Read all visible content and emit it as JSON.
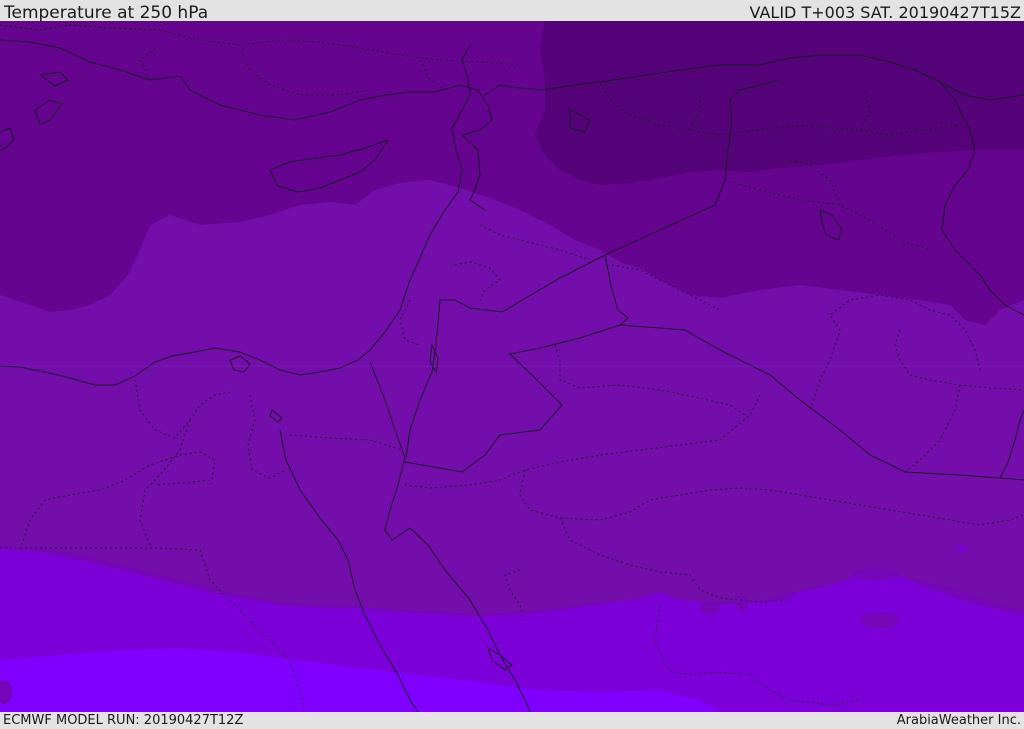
{
  "header": {
    "title": "Temperature at 250 hPa",
    "valid_time": "VALID T+003 SAT. 20190427T15Z"
  },
  "footer": {
    "model_run": "ECMWF MODEL RUN: 20190427T12Z",
    "credit": "ArabiaWeather Inc."
  },
  "map": {
    "bands": [
      {
        "name": "darkest",
        "color": "#540379"
      },
      {
        "name": "dark",
        "color": "#64048f"
      },
      {
        "name": "mid",
        "color": "#730eaa"
      },
      {
        "name": "upper-violet",
        "color": "#7406b8"
      },
      {
        "name": "violet",
        "color": "#7c00d8"
      },
      {
        "name": "bright-violet",
        "color": "#7f00ff"
      }
    ],
    "line_color": "#1a1a2a"
  }
}
